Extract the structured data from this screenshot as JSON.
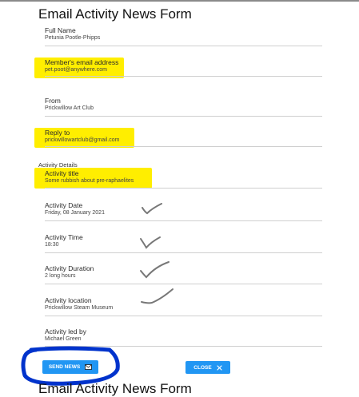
{
  "form": {
    "title": "Email Activity News Form",
    "title_repeat": "Email Activity News Form",
    "section_label": "Activity Details",
    "fields": {
      "full_name": {
        "label": "Full Name",
        "value": "Petunia Pootle-Phipps"
      },
      "member_email": {
        "label": "Member's email address",
        "value": "pet.poot@anywhere.com"
      },
      "from": {
        "label": "From",
        "value": "Prickwillow Art Club"
      },
      "reply_to": {
        "label": "Reply to",
        "value": "prickwillowartclub@gmail.com"
      },
      "activity_title": {
        "label": "Activity title",
        "value": "Some rubbish about pre-raphaelites"
      },
      "activity_date": {
        "label": "Activity Date",
        "value": "Friday, 08 January 2021"
      },
      "activity_time": {
        "label": "Activity Time",
        "value": "18:30"
      },
      "activity_duration": {
        "label": "Activity Duration",
        "value": "2 long hours"
      },
      "activity_location": {
        "label": "Activity location",
        "value": "Prickwillow Steam Museum"
      },
      "activity_led_by": {
        "label": "Activity led by",
        "value": "Michael Green"
      }
    }
  },
  "buttons": {
    "send_news": "SEND NEWS",
    "close": "CLOSE"
  },
  "icons": {
    "send": "envelope-icon",
    "close": "close-icon",
    "check": "check-icon"
  },
  "colors": {
    "highlight": "#ffee00",
    "button": "#2196f3",
    "circle": "#0033cc",
    "check": "#777777"
  }
}
